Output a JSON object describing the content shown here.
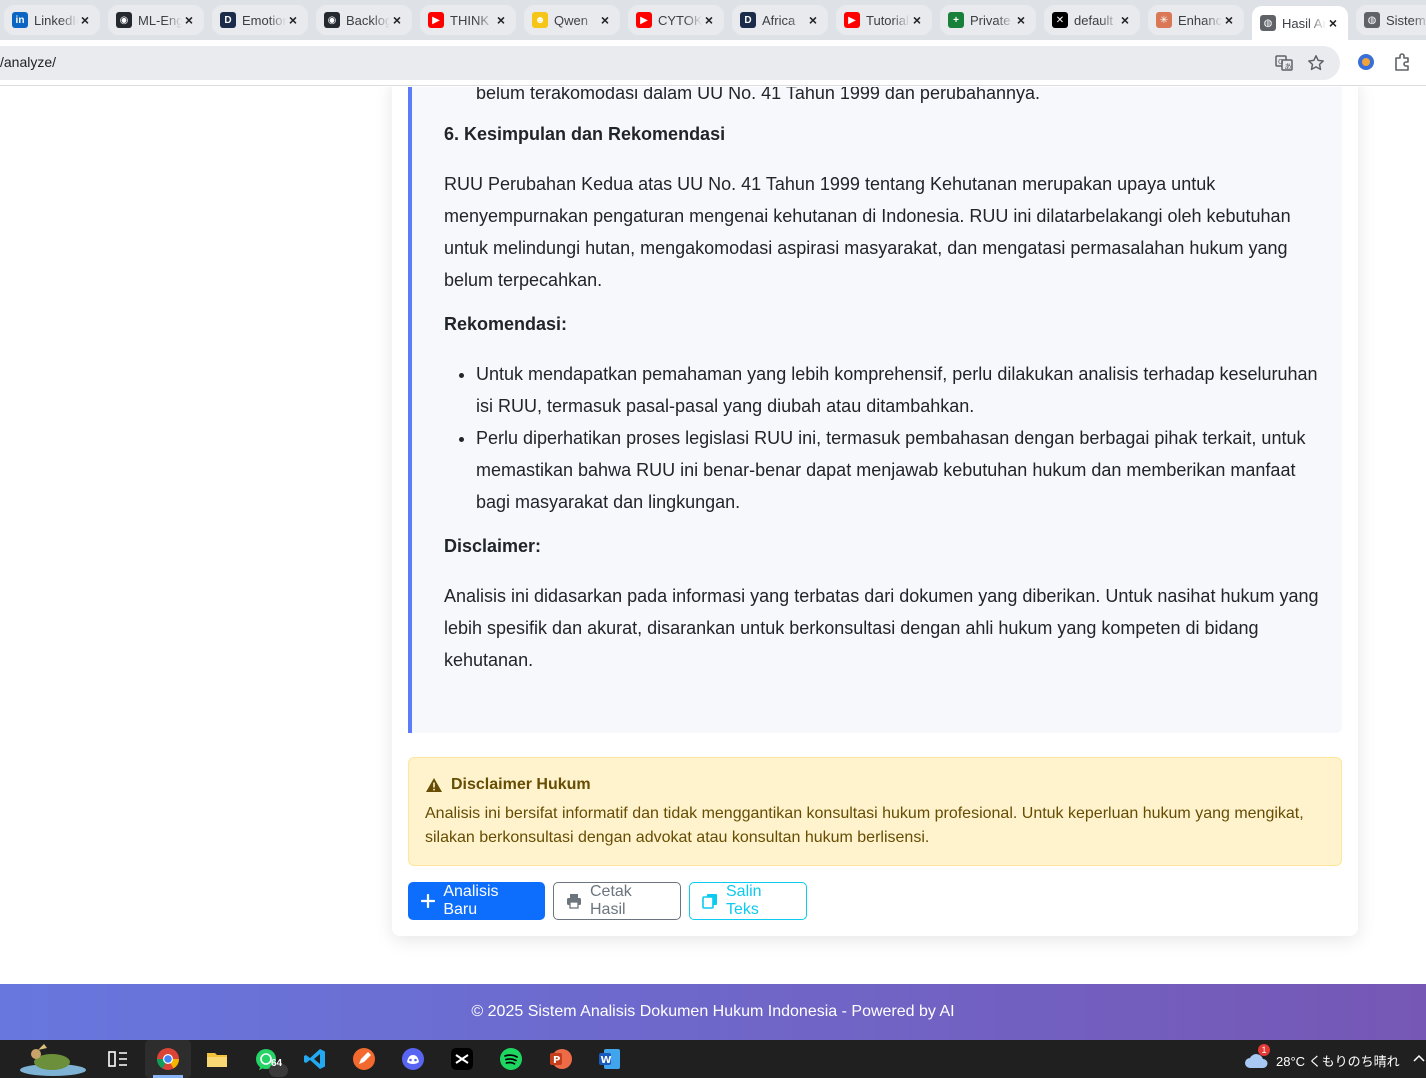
{
  "browser": {
    "tabs": [
      {
        "title": "LinkedIn",
        "icon": "linkedin-icon",
        "color": "#0a66c2",
        "glyph": "in"
      },
      {
        "title": "ML-Engineer",
        "icon": "github-icon",
        "color": "#24292f",
        "glyph": "◉"
      },
      {
        "title": "Emotion",
        "icon": "dagshub-icon",
        "color": "#1b2b4a",
        "glyph": "D"
      },
      {
        "title": "Backlog",
        "icon": "github-icon",
        "color": "#24292f",
        "glyph": "◉"
      },
      {
        "title": "THINK",
        "icon": "youtube-icon",
        "color": "#ff0000",
        "glyph": "▶"
      },
      {
        "title": "Qwen",
        "icon": "qwen-icon",
        "color": "#f5c518",
        "glyph": "☻"
      },
      {
        "title": "CYTOK",
        "icon": "youtube-icon",
        "color": "#ff0000",
        "glyph": "▶"
      },
      {
        "title": "Africa",
        "icon": "dagshub-icon",
        "color": "#1b2b4a",
        "glyph": "D"
      },
      {
        "title": "Tutorial",
        "icon": "youtube-icon",
        "color": "#ff0000",
        "glyph": "▶"
      },
      {
        "title": "Private",
        "icon": "sheets-icon",
        "color": "#188038",
        "glyph": "+"
      },
      {
        "title": "default",
        "icon": "x-icon",
        "color": "#000000",
        "glyph": "✕"
      },
      {
        "title": "Enhance",
        "icon": "claude-icon",
        "color": "#d97757",
        "glyph": "✳"
      },
      {
        "title": "Hasil Analisis",
        "icon": "globe-icon",
        "color": "#5f6368",
        "glyph": "◍"
      },
      {
        "title": "Sistem",
        "icon": "globe-icon",
        "color": "#5f6368",
        "glyph": "◍"
      }
    ],
    "url": "/analyze/"
  },
  "result": {
    "top_line": "belum terakomodasi dalam UU No. 41 Tahun 1999 dan perubahannya.",
    "section_heading": "6. Kesimpulan dan Rekomendasi",
    "conclusion": "RUU Perubahan Kedua atas UU No. 41 Tahun 1999 tentang Kehutanan merupakan upaya untuk menyempurnakan pengaturan mengenai kehutanan di Indonesia. RUU ini dilatarbelakangi oleh kebutuhan untuk melindungi hutan, mengakomodasi aspirasi masyarakat, dan mengatasi permasalahan hukum yang belum terpecahkan.",
    "recommendation_heading": "Rekomendasi:",
    "recommendations": [
      "Untuk mendapatkan pemahaman yang lebih komprehensif, perlu dilakukan analisis terhadap keseluruhan isi RUU, termasuk pasal-pasal yang diubah atau ditambahkan.",
      "Perlu diperhatikan proses legislasi RUU ini, termasuk pembahasan dengan berbagai pihak terkait, untuk memastikan bahwa RUU ini benar-benar dapat menjawab kebutuhan hukum dan memberikan manfaat bagi masyarakat dan lingkungan."
    ],
    "disclaimer_heading": "Disclaimer:",
    "disclaimer_text": "Analisis ini didasarkan pada informasi yang terbatas dari dokumen yang diberikan. Untuk nasihat hukum yang lebih spesifik dan akurat, disarankan untuk berkonsultasi dengan ahli hukum yang kompeten di bidang kehutanan."
  },
  "alert": {
    "title": "Disclaimer Hukum",
    "body": "Analisis ini bersifat informatif dan tidak menggantikan konsultasi hukum profesional. Untuk keperluan hukum yang mengikat, silakan berkonsultasi dengan advokat atau konsultan hukum berlisensi."
  },
  "actions": {
    "new_analysis": "Analisis Baru",
    "print": "Cetak Hasil",
    "copy": "Salin Teks"
  },
  "footer": {
    "text": "© 2025 Sistem Analisis Dokumen Hukum Indonesia - Powered by AI"
  },
  "taskbar": {
    "whatsapp_badge": "64",
    "weather_badge": "1",
    "weather": "28°C くもりのち晴れ"
  },
  "colors": {
    "primary": "#0d6efd",
    "secondary": "#6c757d",
    "info": "#0dcaf0",
    "accent_border": "#5c7cfa",
    "alert_bg": "#fff3cd",
    "footer_start": "#6777de",
    "footer_end": "#7657b5"
  }
}
